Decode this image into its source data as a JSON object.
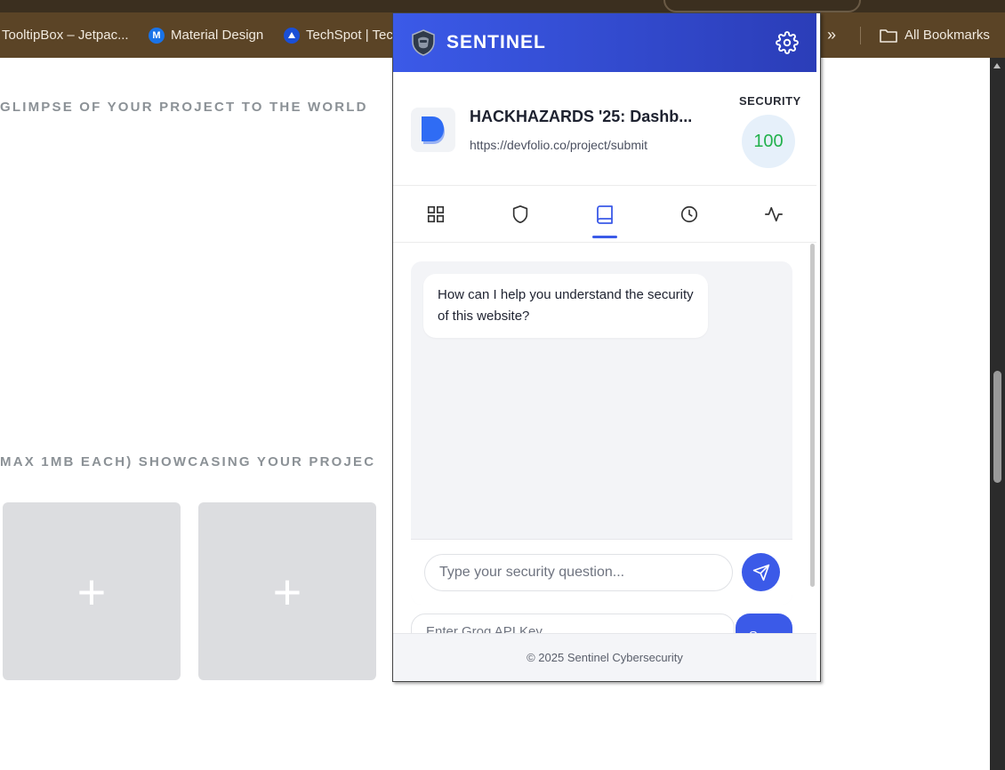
{
  "browser": {
    "bookmarks": [
      {
        "label": "TooltipBox – Jetpac...",
        "icon": "none"
      },
      {
        "label": "Material Design",
        "icon": "material-design-icon",
        "color": "#1a73e8"
      },
      {
        "label": "TechSpot | Tec",
        "icon": "techspot-icon",
        "color": "#1a4fd6"
      }
    ],
    "all_bookmarks": "All Bookmarks"
  },
  "page": {
    "heading_1": "GLIMPSE OF YOUR PROJECT TO THE WORLD",
    "heading_2": "MAX 1MB EACH) SHOWCASING YOUR PROJEC",
    "upload_tiles": [
      "+",
      "+"
    ]
  },
  "popup": {
    "brand": "SENTINEL",
    "site": {
      "title": "HACKHAZARDS '25: Dashb...",
      "url": "https://devfolio.co/project/submit",
      "security_label": "SECURITY",
      "security_score": "100"
    },
    "tabs": [
      {
        "icon": "grid-icon",
        "active": false
      },
      {
        "icon": "shield-icon",
        "active": false
      },
      {
        "icon": "book-icon",
        "active": true
      },
      {
        "icon": "clock-icon",
        "active": false
      },
      {
        "icon": "activity-icon",
        "active": false
      }
    ],
    "chat": {
      "message": "How can I help you understand the security of this website?",
      "input_placeholder": "Type your security question..."
    },
    "api": {
      "placeholder": "Enter Groq API Key",
      "save_label": "Save"
    },
    "footer": "© 2025 Sentinel Cybersecurity"
  },
  "colors": {
    "accent": "#3b5ae8",
    "score": "#22b14c",
    "bookmarks_bar": "#5b4426"
  }
}
